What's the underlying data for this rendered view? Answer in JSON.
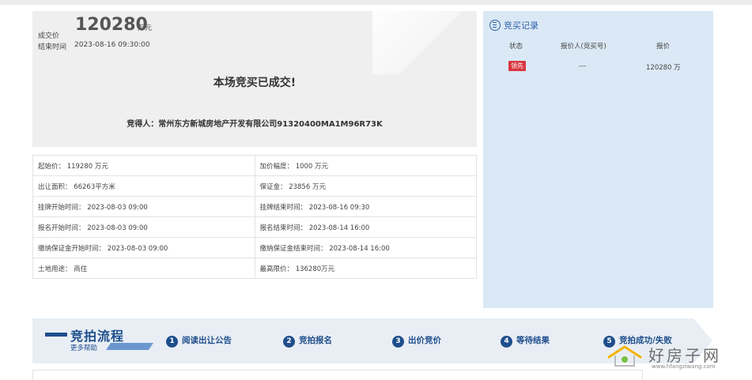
{
  "deal": {
    "price_label": "成交价",
    "price_value": "120280",
    "price_unit": "万元",
    "end_label": "结束时间",
    "end_value": "2023-08-16 09:30:00",
    "status_text": "本场竞买已成交!",
    "winner_text": "竞得人：常州东方新城房地产开发有限公司91320400MA1M96R73K"
  },
  "info": {
    "rows": [
      [
        "起始价：  119280 万元",
        "加价幅度：  1000 万元"
      ],
      [
        "出让面积：  66263平方米",
        "保证金：  23856 万元"
      ],
      [
        "挂牌开始时间：  2023-08-03 09:00",
        "挂牌结束时间：  2023-08-16 09:30"
      ],
      [
        "报名开始时间：  2023-08-03 09:00",
        "报名结束时间：  2023-08-14 16:00"
      ],
      [
        "缴纳保证金开始时间：  2023-08-03 09:00",
        "缴纳保证金结束时间：  2023-08-14 16:00"
      ],
      [
        "土地用途：  商住",
        "最高限价：  136280万元"
      ]
    ]
  },
  "records": {
    "title": "竞买记录",
    "columns": [
      "状态",
      "报价人(竞买号)",
      "报价"
    ],
    "row": {
      "status": "领先",
      "bidder": "---",
      "price": "120280 万"
    },
    "badge_color": "#d9363e"
  },
  "flow": {
    "title": "竞拍流程",
    "help": "更多帮助",
    "steps": [
      {
        "num": "1",
        "label": "阅读出让公告"
      },
      {
        "num": "2",
        "label": "竞拍报名"
      },
      {
        "num": "3",
        "label": "出价竞价"
      },
      {
        "num": "4",
        "label": "等待结果"
      },
      {
        "num": "5",
        "label": "竞拍成功/失败"
      }
    ]
  },
  "watermark": {
    "brand": "好房子网",
    "url": "www.hfangziwang.com",
    "icon": "house-icon"
  },
  "colors": {
    "accent": "#1e4e8c",
    "panel_bg": "#dbe9f6",
    "deal_bg": "#efefef"
  }
}
